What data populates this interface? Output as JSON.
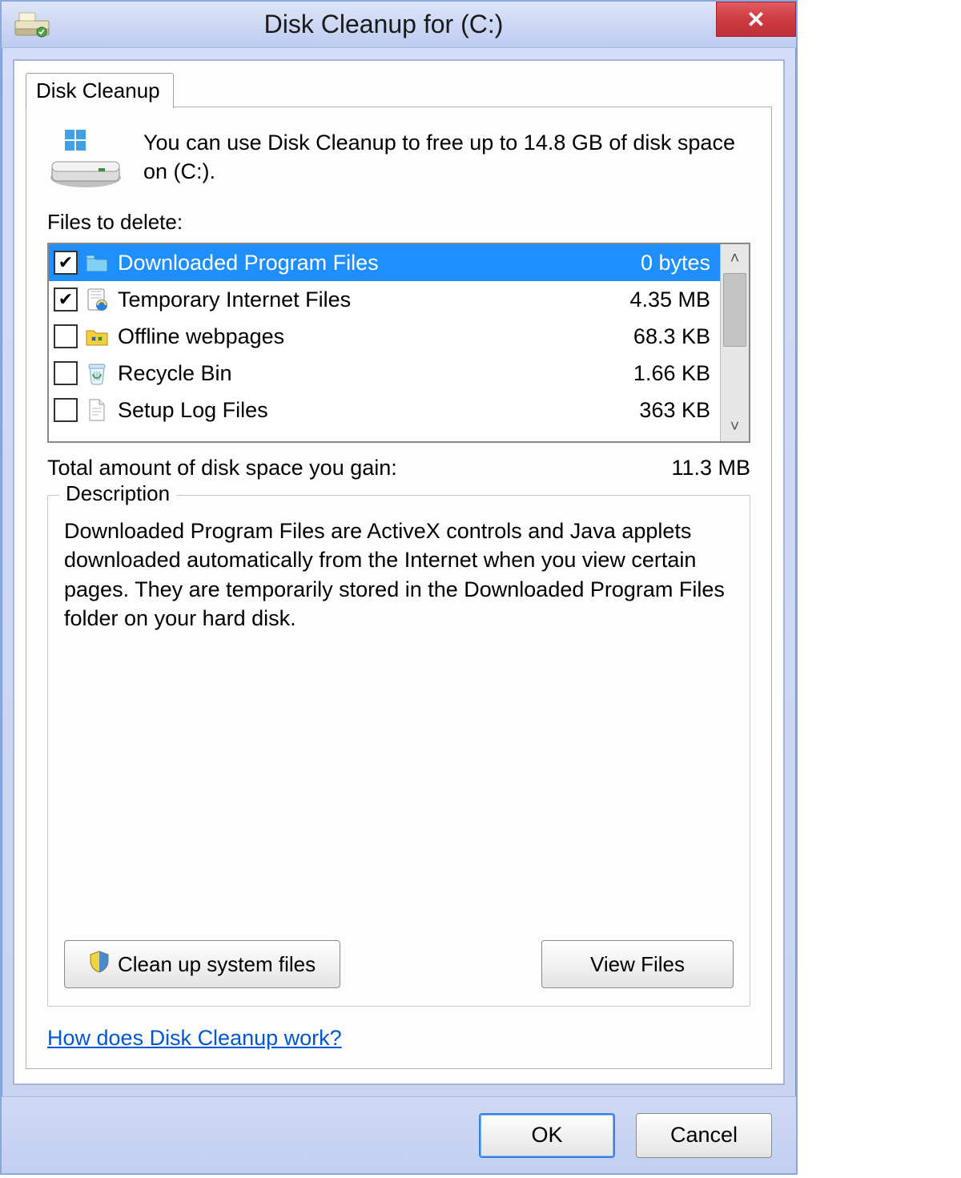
{
  "window": {
    "title": "Disk Cleanup for  (C:)",
    "close_glyph": "✕"
  },
  "tab": {
    "label": "Disk Cleanup"
  },
  "intro": {
    "text": "You can use Disk Cleanup to free up to 14.8 GB of disk space on  (C:)."
  },
  "files_section_label": "Files to delete:",
  "file_items": [
    {
      "name": "Downloaded Program Files",
      "size": "0 bytes",
      "checked": true,
      "selected": true,
      "icon": "folder-icon"
    },
    {
      "name": "Temporary Internet Files",
      "size": "4.35 MB",
      "checked": true,
      "selected": false,
      "icon": "ie-cache-icon"
    },
    {
      "name": "Offline webpages",
      "size": "68.3 KB",
      "checked": false,
      "selected": false,
      "icon": "offline-pages-icon"
    },
    {
      "name": "Recycle Bin",
      "size": "1.66 KB",
      "checked": false,
      "selected": false,
      "icon": "recycle-bin-icon"
    },
    {
      "name": "Setup Log Files",
      "size": "363 KB",
      "checked": false,
      "selected": false,
      "icon": "log-file-icon"
    }
  ],
  "total": {
    "label": "Total amount of disk space you gain:",
    "value": "11.3 MB"
  },
  "description": {
    "legend": "Description",
    "text": "Downloaded Program Files are ActiveX controls and Java applets downloaded automatically from the Internet when you view certain pages. They are temporarily stored in the Downloaded Program Files folder on your hard disk.",
    "cleanup_button": "Clean up system files",
    "view_button": "View Files"
  },
  "help_link": "How does Disk Cleanup work?",
  "footer": {
    "ok": "OK",
    "cancel": "Cancel"
  }
}
